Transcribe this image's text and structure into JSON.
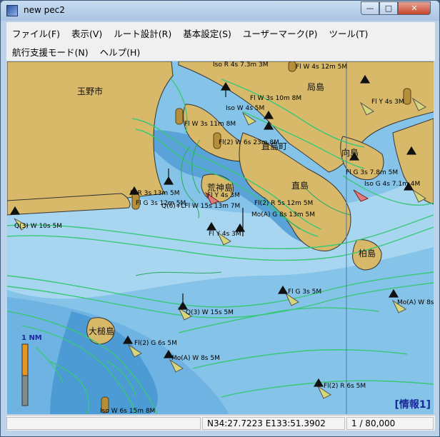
{
  "window": {
    "title": "new pec2"
  },
  "menu": {
    "row1": [
      "ファイル(F)",
      "表示(V)",
      "ルート設計(R)",
      "基本設定(S)",
      "ユーザーマーク(P)",
      "ツール(T)"
    ],
    "row2": [
      "航行支援モード(N)",
      "ヘルプ(H)"
    ]
  },
  "map": {
    "places": [
      "玉野市",
      "局島",
      "直島町",
      "向島",
      "荒神島",
      "直島",
      "柏島",
      "大槌島"
    ],
    "lights": [
      "Iso R 4s 7.3m 3M",
      "Fl W 4s 12m 5M",
      "Fl W 3s 10m 8M",
      "Iso W 4s 5M",
      "Fl Y 4s 3M",
      "Fl W 3s 11m 8M",
      "Fl(2) W 6s 23m 8M",
      "Fl G 3s 7.8m 5M",
      "Iso G 4s 7.1m 4M",
      "Fl Y 4s 3M",
      "Fl R 3s 13m 5M",
      "Fl G 3s 12m 5M",
      "Fl(2) R 5s 12m 5M",
      "Q(6)+LFl W 15s 13m 7M",
      "Mo(A) G 8s 13m 5M",
      "Q(3) W 10s 5M",
      "Fl Y 4s 3M",
      "Fl G 3s 5M",
      "Mo(A) W 8s",
      "Q(3) W 15s 5M",
      "Fl(2) G 6s 5M",
      "Mo(A) W 8s 5M",
      "Fl(2) R 6s 5M",
      "Iso W 6s 15m 8M"
    ],
    "info_label": "[情報1]",
    "scale_label": "1 NM"
  },
  "status": {
    "coordinates": "N34:27.7223 E133:51.3902",
    "scale": "1 / 80,000"
  },
  "colors": {
    "land": "#d8b96a",
    "shallow_water": "#5fa8dc",
    "deep_water": "#86c3e8",
    "contour": "#38c878",
    "info_text": "#1a2a9a"
  }
}
